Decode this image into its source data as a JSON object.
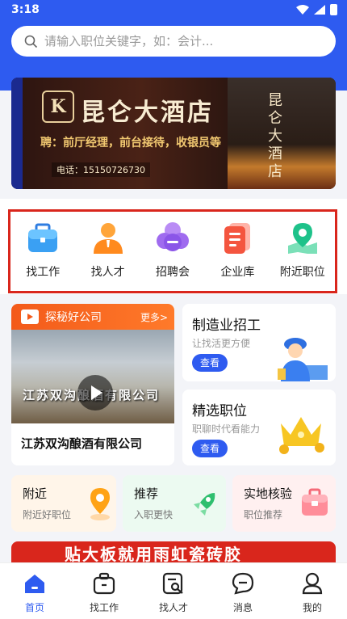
{
  "status_bar": {
    "time": "3:18"
  },
  "search": {
    "placeholder": "请输入职位关键字，如：会计..."
  },
  "banner": {
    "logo_text": "K",
    "title": "昆仑大酒店",
    "subtitle": "聘：前厅经理，前台接待，收银员等",
    "phone": "电话：15150726730",
    "building_sign": "昆仑大酒店"
  },
  "quick_links": [
    {
      "label": "找工作",
      "icon": "briefcase-icon"
    },
    {
      "label": "找人才",
      "icon": "person-icon"
    },
    {
      "label": "招聘会",
      "icon": "fair-cloud-icon"
    },
    {
      "label": "企业库",
      "icon": "company-doc-icon"
    },
    {
      "label": "附近职位",
      "icon": "map-pin-icon"
    }
  ],
  "explore": {
    "header": "探秘好公司",
    "more": "更多>",
    "video_text": "江苏双沟酿酒有限公司",
    "company_name": "江苏双沟酿酒有限公司"
  },
  "cards": {
    "manufacturing": {
      "title": "制造业招工",
      "subtitle": "让找活更方便",
      "button": "查看"
    },
    "featured": {
      "title": "精选职位",
      "subtitle": "职聊时代看能力",
      "button": "查看"
    }
  },
  "mini_cards": [
    {
      "title": "附近",
      "subtitle": "附近好职位"
    },
    {
      "title": "推荐",
      "subtitle": "入职更快"
    },
    {
      "title": "实地核验",
      "subtitle": "职位推荐"
    }
  ],
  "promo": {
    "text": "贴大板就用雨虹瓷砖胶"
  },
  "tabbar": [
    {
      "label": "首页",
      "icon": "home-icon"
    },
    {
      "label": "找工作",
      "icon": "job-bag-icon"
    },
    {
      "label": "找人才",
      "icon": "talent-search-icon"
    },
    {
      "label": "消息",
      "icon": "message-icon"
    },
    {
      "label": "我的",
      "icon": "profile-icon"
    }
  ],
  "colors": {
    "primary": "#2e5bf0",
    "highlight_border": "#d9261c",
    "explore_orange": "#f35a1a"
  }
}
